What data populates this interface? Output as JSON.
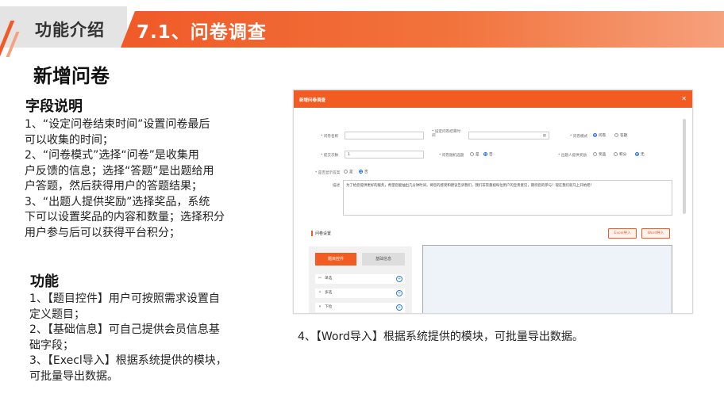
{
  "header": {
    "section_label": "功能介绍",
    "chapter_title": "7.1、问卷调查",
    "accent_color": "#ef5a28"
  },
  "page_title": "新增问卷",
  "field_notes": {
    "heading": "字段说明",
    "lines": [
      "1、“设定问卷结束时间”设置问卷最后",
      "可以收集的时间；",
      "2、“问卷模式”选择“问卷”是收集用",
      "户反馈的信息；选择“答题”是出题给用",
      "户答题，然后获得用户的答题结果；",
      "3、“出题人提供奖励”选择奖品，系统",
      "下可以设置奖品的内容和数量；选择积分",
      "用户参与后可以获得平台积分；"
    ]
  },
  "functions": {
    "heading": "功能",
    "lines": [
      "1、【题目控件】用户可按照需求设置自",
      "定义题目；",
      "2、【基础信息】可自己提供会员信息基",
      "础字段；",
      "3、【Execl导入】根据系统提供的模块，",
      "可批量导出数据。"
    ],
    "line4": "4、【Word导入】根据系统提供的模块，可批量导出数据。"
  },
  "screenshot": {
    "window_title": "新增问卷调查",
    "close_icon": "close-icon",
    "fields": {
      "name_label": "* 问卷名称",
      "end_time_label": "* 设定问卷结束时间",
      "mode_label": "* 问卷模式",
      "mode_options": [
        "问卷",
        "答题"
      ],
      "submit_count_label": "* 提交次数",
      "submit_count_value": "1",
      "random_label": "* 问卷随机选题",
      "random_options": [
        "是",
        "否"
      ],
      "reward_label": "* 出题人提供奖励",
      "reward_options": [
        "奖品",
        "积分",
        "无"
      ],
      "show_answer_label": "* 是否显示答案",
      "show_answer_options": [
        "是",
        "否"
      ],
      "desc_label": "描述",
      "desc_value": "为了给您提供更好的服务，希望您能抽出几分钟时间，将您的感受和建议告诉我们，我们非常重视每位用户的宝贵意见，期待您的参与！现在我们就马上开始吧！"
    },
    "question_settings": {
      "title": "问卷设置",
      "excel_button": "Excel导入",
      "word_button": "Word导入",
      "tab_controls": "题目控件",
      "tab_basic": "基础信息",
      "controls": [
        "单选",
        "多选",
        "下拉"
      ]
    }
  }
}
